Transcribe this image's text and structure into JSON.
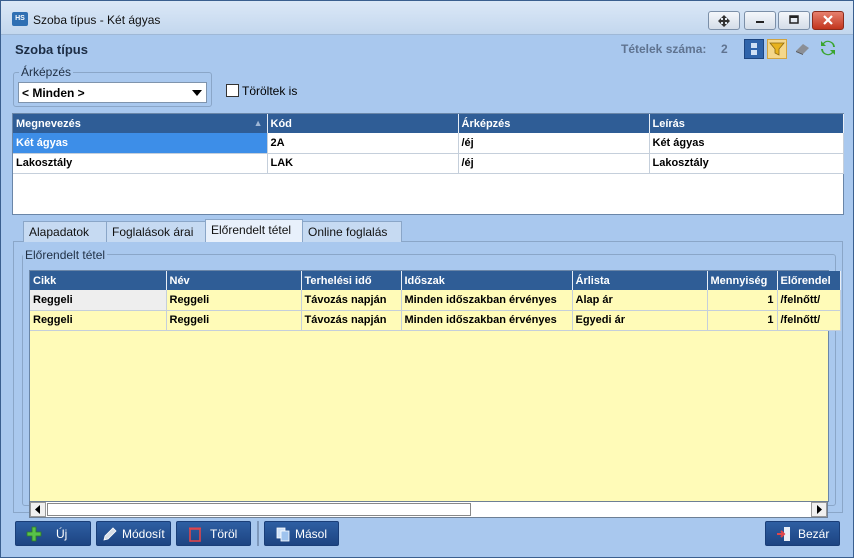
{
  "window": {
    "title": "Szoba típus - Két ágyas",
    "app_icon_text": "HS"
  },
  "header": {
    "title": "Szoba típus",
    "count_label": "Tételek száma:",
    "count_value": "2"
  },
  "filter": {
    "group_label": "Árképzés",
    "select_value": "< Minden >",
    "checkbox_label": "Töröltek is",
    "checkbox_checked": false
  },
  "top_grid": {
    "columns": [
      "Megnevezés",
      "Kód",
      "Árképzés",
      "Leírás"
    ],
    "sort_column": "Megnevezés",
    "sort_direction": "ascending",
    "rows": [
      {
        "name": "Két ágyas",
        "code": "2A",
        "pricing": "/éj",
        "desc": "Két ágyas",
        "selected": true
      },
      {
        "name": "Lakosztály",
        "code": "LAK",
        "pricing": "/éj",
        "desc": "Lakosztály",
        "selected": false
      }
    ]
  },
  "tabs": [
    {
      "label": "Alapadatok",
      "active": false
    },
    {
      "label": "Foglalások árai",
      "active": false
    },
    {
      "label": "Előrendelt tétel",
      "active": true
    },
    {
      "label": "Online foglalás",
      "active": false
    }
  ],
  "detail": {
    "group_label": "Előrendelt tétel",
    "columns": [
      "Cikk",
      "Név",
      "Terhelési idő",
      "Időszak",
      "Árlista",
      "Mennyiség",
      "Előrendel"
    ],
    "rows": [
      {
        "item": "Reggeli",
        "name": "Reggeli",
        "charge": "Távozás napján",
        "period": "Minden időszakban érvényes",
        "pricelist": "Alap ár",
        "qty": "1",
        "pre": "/felnőtt/"
      },
      {
        "item": "Reggeli",
        "name": "Reggeli",
        "charge": "Távozás napján",
        "period": "Minden időszakban érvényes",
        "pricelist": "Egyedi ár",
        "qty": "1",
        "pre": "/felnőtt/"
      }
    ]
  },
  "footer": {
    "new_label": "Új",
    "edit_label": "Módosít",
    "delete_label": "Töröl",
    "copy_label": "Másol",
    "close_label": "Bezár"
  }
}
